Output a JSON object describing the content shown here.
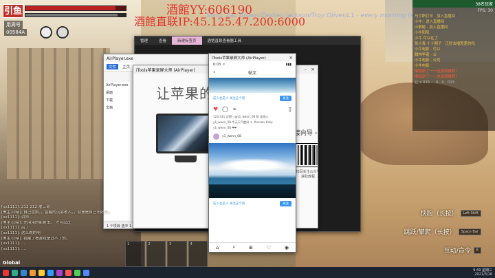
{
  "overlay": {
    "yy": "酒館YY:606190",
    "qq": "酒館直联IP:45.125.47.200:6000",
    "song": "Song: Zac Brown/Zeshan Jackson/Troy Oliver/L1 - every morning (every morning)"
  },
  "hud": {
    "badge": "引鱼",
    "name_label": "用周号",
    "coins": "00584A",
    "health_fraction": 0.9,
    "stamina_fraction": 0.92
  },
  "windows": {
    "explorer": {
      "title": "AirPlayer.exe",
      "ribbon": [
        "文件",
        "主页",
        "共享",
        "查看"
      ],
      "tree": [
        "AirPlayer.exe",
        "桌面",
        "下载",
        "文档"
      ],
      "status": "1 个项目 选中 1 个项目 14,214,656 字节"
    },
    "dark": {
      "tabs": [
        "管理",
        "查看",
        "新建标签页",
        "酒馆直联查看器工具"
      ]
    },
    "itools": {
      "title": "iTools苹果录屏大师 (AirPlayer)",
      "hero": "让苹果的A  ·  ·  精彩",
      "link": "接向导 ›",
      "qr_caption": "扫码关注公众号 获取教程"
    },
    "airplayer": {
      "title": "iTools苹果录屏大师 (AirPlayer)",
      "time": "6:03 ↗",
      "battery": "▮▮▮",
      "nav_title": "帖文",
      "tag": "成人也是人 关注这个吧",
      "follow": "关注",
      "likes_text": "123,411 次赞 · @y1_wenn_08 和 其他人",
      "caption": "y1_wenn_08 今天天气超好 ☀ #ocean #sky",
      "comment": "y1_wenn_08 ❤❤",
      "user": "y1_wenn_08",
      "tab_icons": [
        "⌂",
        "⌕",
        "⊞",
        "♡",
        "◉"
      ]
    }
  },
  "chat": {
    "lines": [
      "[xx1111]: 212   212  曜三哥",
      "[黑主·印帝]: 自己这娘。，曾醒的沉影老人。，就是是自己出好了。",
      "[xx1111]: 讲师",
      "[黑主·印帝]: 先用用的新射击。 才可以过",
      "[xx1111]: 吕了",
      "[xx1111]: 这么晚的啊",
      "[黑主·印帝]: 我醒了看游戏是过不了的。",
      "[xx1111]: ....",
      "[xx1111]: ...."
    ],
    "global_label": "Global"
  },
  "hotbar": [
    "1",
    "2",
    "3",
    "4"
  ],
  "right_panel": {
    "header": "38名玩家",
    "fps": "FPS: 30",
    "lines": [
      {
        "t": "乌尔斯打印 · 加入直播间",
        "c": "normal"
      },
      {
        "t": "小牛：进入直播间",
        "c": "normal"
      },
      {
        "t": "火箭砸 · 加入直播间",
        "c": "normal"
      },
      {
        "t": "小牛阳阳",
        "c": "normal"
      },
      {
        "t": "小牛·可以在了",
        "c": "normal"
      },
      {
        "t": "张小青·十十刚子 · 正好去播差差的吗",
        "c": "normal"
      },
      {
        "t": "小牛电影 · 可以",
        "c": "normal"
      },
      {
        "t": "翰林学者 · 公",
        "c": "normal"
      },
      {
        "t": "小牛电影 · 公司",
        "c": "normal"
      },
      {
        "t": "小牛电影",
        "c": "normal"
      },
      {
        "t": "喉咙剖了一一这游戏推荐！",
        "c": "red"
      },
      {
        "t": "喉咙剖了一一这游戏推荐！",
        "c": "red"
      },
      {
        "t": "让 x 015 · · 0 · 0 · 015 ·",
        "c": "gray"
      }
    ]
  },
  "hints": [
    {
      "label": "快跑（长按）",
      "key": "Left Shift"
    },
    {
      "label": "跳跃/攀爬（长按）",
      "key": "Space Bar"
    },
    {
      "label": "互动/命令",
      "key": "E"
    }
  ],
  "taskbar": {
    "clock_time": "9:49 星期三",
    "clock_date": "2021/3/16",
    "icon_colors": [
      "#e33",
      "#3a8",
      "#38c",
      "#e93",
      "#fc3",
      "#39f",
      "#a4c",
      "#f55",
      "#5c5",
      "#58f"
    ]
  }
}
